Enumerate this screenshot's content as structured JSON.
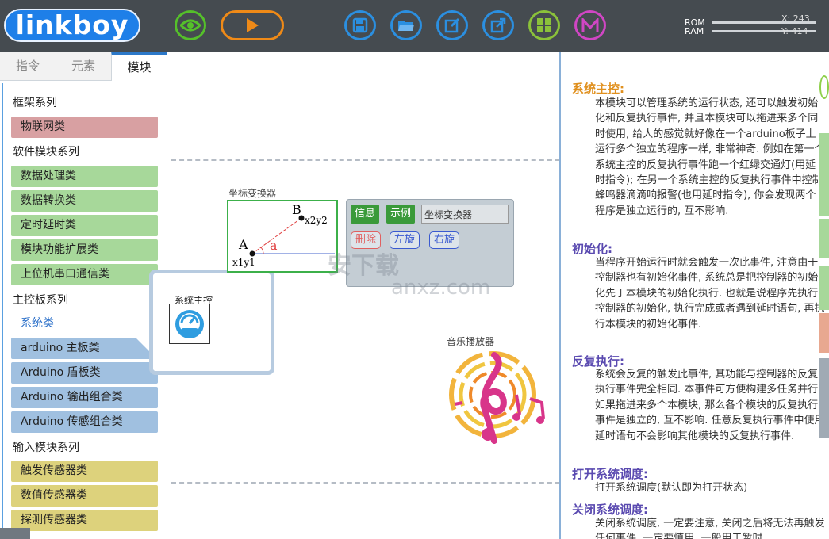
{
  "app": {
    "logo": "linkboy"
  },
  "toolbar": {
    "icons": [
      "eye-icon",
      "play-icon",
      "save-icon",
      "open-folder-icon",
      "edit-icon",
      "export-icon",
      "grid-icon",
      "m-icon"
    ],
    "rom_label": "ROM",
    "ram_label": "RAM",
    "x_readout": "X: 243",
    "y_readout": "Y: 414"
  },
  "left_tabs": {
    "t1": "指令",
    "t2": "元素",
    "t3": "模块"
  },
  "categories": {
    "s1": "框架系列",
    "c1": "物联网类",
    "s2": "软件模块系列",
    "c2": "数据处理类",
    "c3": "数据转换类",
    "c4": "定时延时类",
    "c5": "模块功能扩展类",
    "c6": "上位机串口通信类",
    "s3": "主控板系列",
    "c7": "系统类",
    "c8": "arduino 主板类",
    "c9": "Arduino 盾板类",
    "c10": "Arduino 输出组合类",
    "c11": "Arduino 传感组合类",
    "s4": "输入模块系列",
    "c12": "触发传感器类",
    "c13": "数值传感器类",
    "c14": "探测传感器类"
  },
  "canvas": {
    "popup_label": "系统主控",
    "coord_label": "坐标变换器",
    "point_a": "A",
    "point_b": "B",
    "a_coords": "x1y1",
    "b_coords": "x2y2",
    "angle": "a",
    "btn_info": "信息",
    "btn_example": "示例",
    "name_field": "坐标变换器",
    "btn_delete": "删除",
    "btn_rotate_left": "左旋",
    "btn_rotate_right": "右旋",
    "music_label": "音乐播放器",
    "watermark": "安下载",
    "watermark_sub": "anxz.com"
  },
  "doc": {
    "h1": "系统主控:",
    "p1": "本模块可以管理系统的运行状态, 还可以触发初始化和反复执行事件, 并且本模块可以拖进来多个同时使用, 给人的感觉就好像在一个arduino板子上运行多个独立的程序一样, 非常神奇. 例如在第一个系统主控的反复执行事件跑一个红绿交通灯(用延时指令); 在另一个系统主控的反复执行事件中控制蜂鸣器滴滴响报警(也用延时指令), 你会发现两个程序是独立运行的, 互不影响.",
    "h2": "初始化:",
    "p2": "当程序开始运行时就会触发一次此事件, 注意由于控制器也有初始化事件, 系统总是把控制器的初始化先于本模块的初始化执行. 也就是说程序先执行控制器的初始化, 执行完成或者遇到延时语句, 再执行本模块的初始化事件.",
    "h3": "反复执行:",
    "p3": "系统会反复的触发此事件, 其功能与控制器的反复执行事件完全相同. 本事件可方便构建多任务并行, 如果拖进来多个本模块, 那么各个模块的反复执行事件是独立的, 互不影响. 任意反复执行事件中使用延时语句不会影响其他模块的反复执行事件.",
    "h4": "打开系统调度:",
    "p4": "打开系统调度(默认即为打开状态)",
    "h5": "关闭系统调度:",
    "p5": "关闭系统调度, 一定要注意, 关闭之后将无法再触发任何事件, 一定要慎用, 一般用于暂时"
  },
  "colors": {
    "topbar": "#454b50",
    "logo": "#1e7fe8",
    "heading_orange": "#e0901e",
    "heading_purple": "#5a4ab0"
  }
}
